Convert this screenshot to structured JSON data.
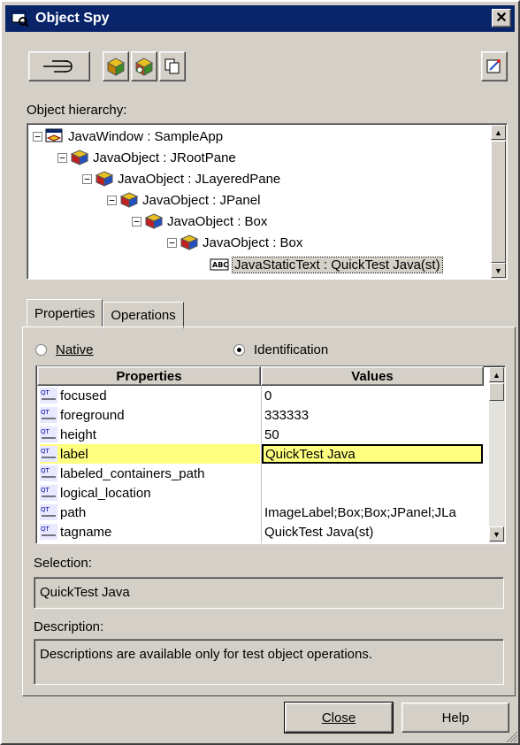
{
  "window": {
    "title": "Object Spy",
    "close_glyph": "✕"
  },
  "toolbar": {
    "pointer_icon": "pointing-hand-icon",
    "tool_icons": [
      "test-object-cube-icon",
      "run-object-cube-icon",
      "copy-clipboard-icon"
    ],
    "pin_icon": "keep-on-top-icon"
  },
  "hierarchy": {
    "label": "Object hierarchy:",
    "nodes": [
      {
        "text": "JavaWindow : SampleApp",
        "icon": "java-window-icon",
        "expander": "−"
      },
      {
        "text": "JavaObject : JRootPane",
        "icon": "java-object-icon",
        "expander": "−"
      },
      {
        "text": "JavaObject : JLayeredPane",
        "icon": "java-object-icon",
        "expander": "−"
      },
      {
        "text": "JavaObject : JPanel",
        "icon": "java-object-icon",
        "expander": "−"
      },
      {
        "text": "JavaObject : Box",
        "icon": "java-object-icon",
        "expander": "−"
      },
      {
        "text": "JavaObject : Box",
        "icon": "java-object-icon",
        "expander": "−"
      },
      {
        "text": "JavaStaticText : QuickTest Java(st)",
        "icon": "static-text-icon",
        "expander": ""
      }
    ]
  },
  "tabs": [
    "Properties",
    "Operations"
  ],
  "modes": {
    "native": "Native",
    "identification": "Identification",
    "selected": "Identification"
  },
  "grid": {
    "headers": [
      "Properties",
      "Values"
    ],
    "rows": [
      {
        "name": "focused",
        "value": "0"
      },
      {
        "name": "foreground",
        "value": "333333"
      },
      {
        "name": "height",
        "value": "50"
      },
      {
        "name": "label",
        "value": "QuickTest Java",
        "selected": true
      },
      {
        "name": "labeled_containers_path",
        "value": ""
      },
      {
        "name": "logical_location",
        "value": ""
      },
      {
        "name": "path",
        "value": "ImageLabel;Box;Box;JPanel;JLa"
      },
      {
        "name": "tagname",
        "value": "QuickTest Java(st)"
      }
    ]
  },
  "selection": {
    "label": "Selection:",
    "value": "QuickTest Java"
  },
  "description": {
    "label": "Description:",
    "value": "Descriptions are available only for test object operations."
  },
  "buttons": {
    "close": "Close",
    "help": "Help"
  },
  "colors": {
    "title_bar": "#0a246a",
    "face": "#d4d0c8",
    "highlight": "#ffff80"
  }
}
